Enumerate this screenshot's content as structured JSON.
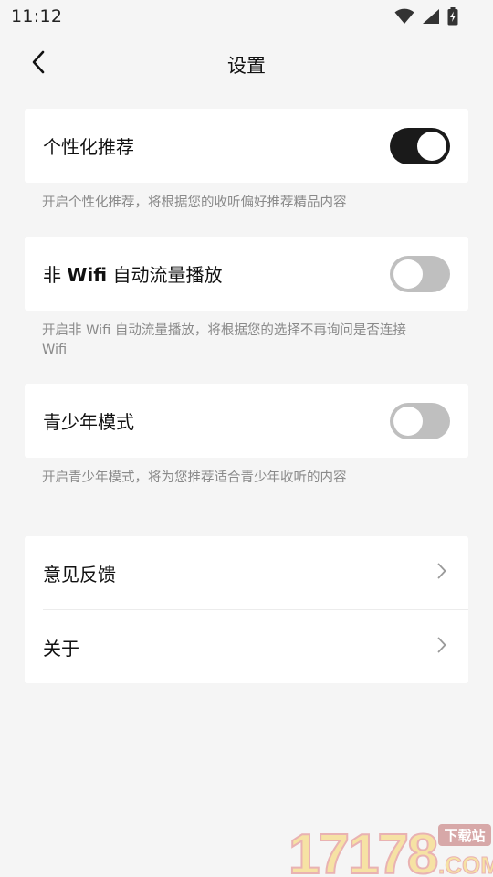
{
  "status_bar": {
    "time": "11:12",
    "icons": [
      "wifi-icon",
      "signal-icon",
      "battery-charging-icon"
    ]
  },
  "header": {
    "title": "设置",
    "back_icon": "chevron-left-icon"
  },
  "settings": {
    "personalized": {
      "label": "个性化推荐",
      "enabled": true,
      "description": "开启个性化推荐，将根据您的收听偏好推荐精品内容"
    },
    "auto_play": {
      "label_prefix": "非 ",
      "label_bold": "Wifi",
      "label_suffix": " 自动流量播放",
      "enabled": false,
      "description_line1": "开启非 Wifi 自动流量播放，将根据您的选择不再询问是否连接",
      "description_line2": "Wifi"
    },
    "teen_mode": {
      "label": "青少年模式",
      "enabled": false,
      "description": "开启青少年模式，将为您推荐适合青少年收听的内容"
    }
  },
  "links": {
    "feedback": {
      "label": "意见反馈",
      "icon": "chevron-right-icon"
    },
    "about": {
      "label": "关于",
      "icon": "chevron-right-icon"
    }
  },
  "watermark": {
    "number": "17178",
    "badge": "下载站",
    "domain": ".COM"
  },
  "colors": {
    "background": "#f5f5f5",
    "card": "#ffffff",
    "toggle_on": "#1a1a1a",
    "toggle_off": "#bfbfbf",
    "secondary_text": "#8a8a8a"
  }
}
